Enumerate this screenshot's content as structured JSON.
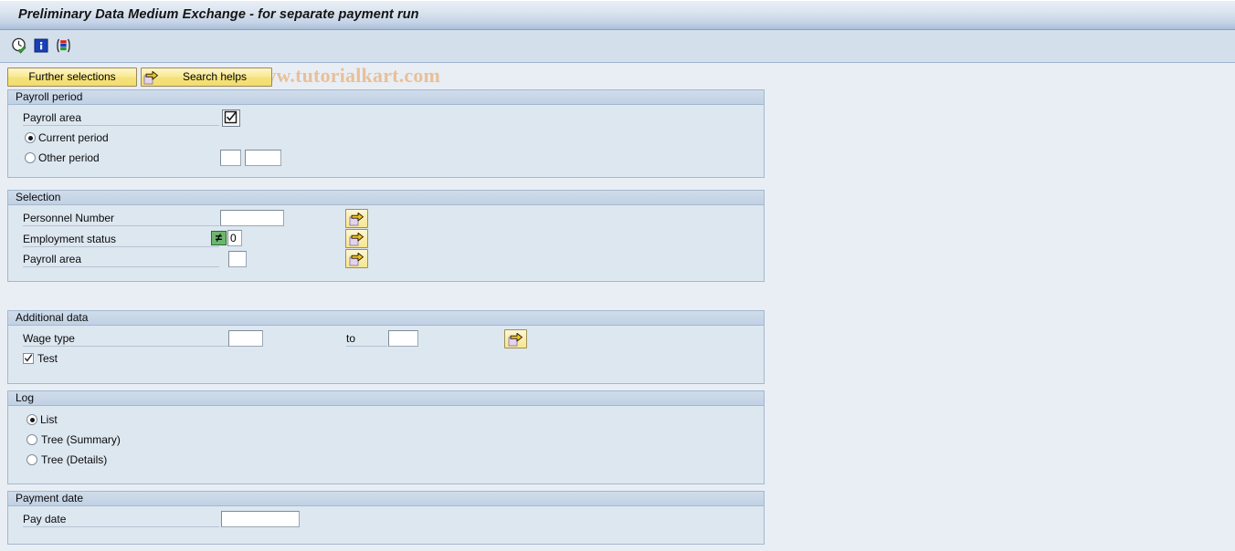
{
  "window": {
    "title": "Preliminary Data Medium Exchange - for separate payment run"
  },
  "watermark": {
    "text": "© www.tutorialkart.com"
  },
  "toolbar": {
    "icons": [
      {
        "name": "execute-clock-icon",
        "title": "Execute"
      },
      {
        "name": "information-icon",
        "title": "Information"
      },
      {
        "name": "variant-icon",
        "title": "Get variant"
      }
    ]
  },
  "actions": {
    "further_selections": "Further selections",
    "search_helps": "Search helps",
    "arrow_icon": "multiple-selection-arrow-icon"
  },
  "sections": {
    "payroll_period": {
      "title": "Payroll period",
      "payroll_area_label": "Payroll area",
      "payroll_area_button_icon": "checked-checkbox-icon",
      "current_period_label": "Current period",
      "other_period_label": "Other period",
      "period_selected": "Current period",
      "other_period_value_1": "",
      "other_period_value_2": ""
    },
    "selection": {
      "title": "Selection",
      "rows": [
        {
          "label": "Personnel Number",
          "value": "",
          "has_operator": false,
          "operator": "",
          "arrow": "multiple-selection-arrow-icon"
        },
        {
          "label": "Employment status",
          "value": "0",
          "has_operator": true,
          "operator": "≠",
          "arrow": "multiple-selection-arrow-icon"
        },
        {
          "label": "Payroll area",
          "value": "",
          "has_operator": false,
          "operator": "",
          "arrow": "multiple-selection-arrow-icon"
        }
      ]
    },
    "additional_data": {
      "title": "Additional data",
      "wage_type_label": "Wage type",
      "wage_type_from": "",
      "to_label": "to",
      "wage_type_to": "",
      "arrow": "multiple-selection-arrow-icon",
      "test_label": "Test",
      "test_checked": true
    },
    "log": {
      "title": "Log",
      "options": [
        {
          "label": "List",
          "selected": true
        },
        {
          "label": "Tree (Summary)",
          "selected": false
        },
        {
          "label": "Tree (Details)",
          "selected": false
        }
      ]
    },
    "payment_date": {
      "title": "Payment date",
      "pay_date_label": "Pay date",
      "pay_date_value": ""
    }
  },
  "colors": {
    "background": "#e9eef5",
    "group_bg": "#dde7f0",
    "group_header": "#c6d4e6",
    "button_yellow": "#f5e27c",
    "operator_green": "#6db56d",
    "watermark": "#e8bd90"
  }
}
